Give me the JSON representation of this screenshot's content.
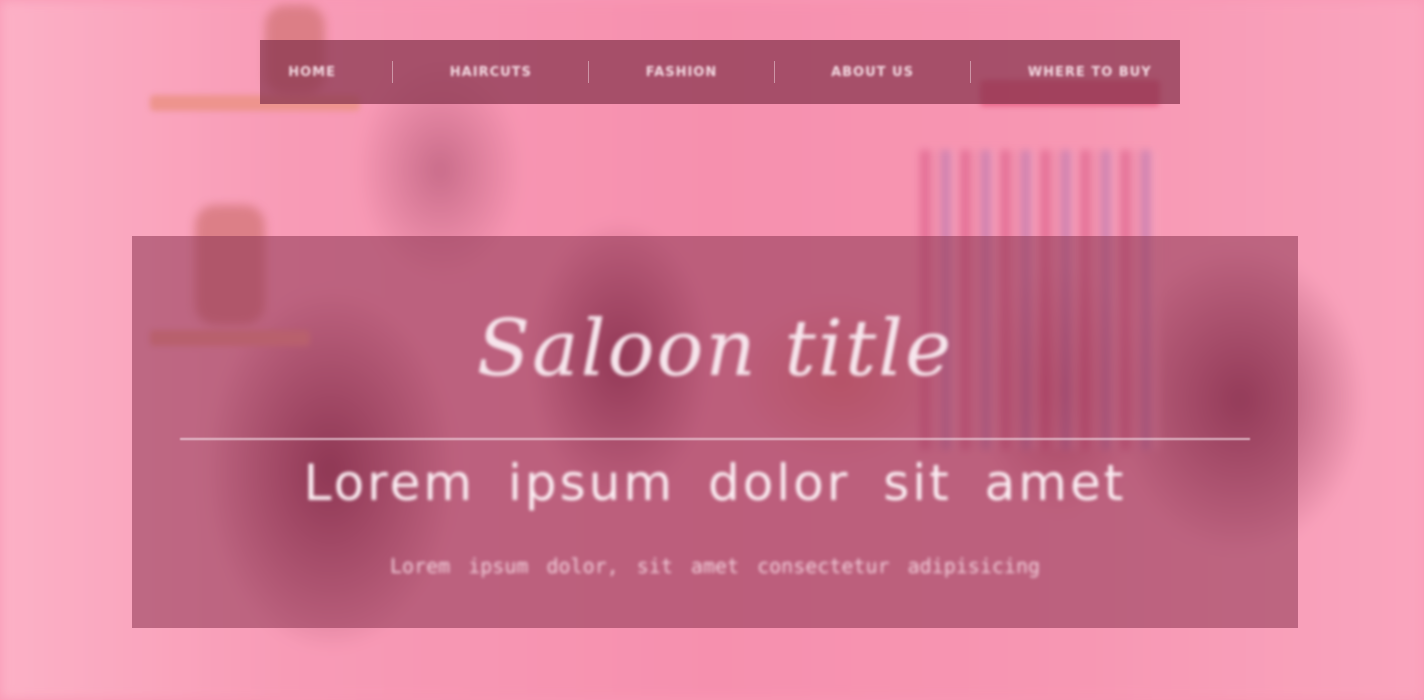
{
  "nav": {
    "items": [
      {
        "label": "HOME"
      },
      {
        "label": "HAIRCUTS"
      },
      {
        "label": "FASHION"
      },
      {
        "label": "ABOUT US"
      },
      {
        "label": "WHERE TO BUY"
      }
    ]
  },
  "hero": {
    "title": "Saloon title",
    "subtitle": "Lorem ipsum dolor sit amet",
    "tagline": "Lorem ipsum dolor, sit amet consectetur adipisicing"
  },
  "colors": {
    "overlay": "#ff6e96",
    "nav_bg": "#87344e",
    "hero_bg": "#8c3452",
    "text": "#f6e5ec"
  }
}
